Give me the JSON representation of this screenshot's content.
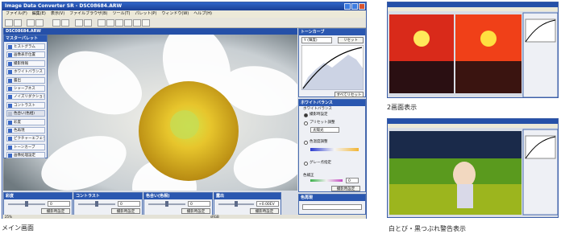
{
  "main_window": {
    "title": "Image Data Converter SR - DSC08684.ARW",
    "menus": [
      "ファイル(F)",
      "編集(E)",
      "表示(V)",
      "ファイルブラウザ(B)",
      "ツール(T)",
      "パレット(P)",
      "ウィンドウ(W)",
      "ヘルプ(H)"
    ],
    "image_title": "DSC08684.ARW",
    "master_palette": {
      "title": "マスターパレット",
      "items": [
        {
          "label": "ヒストグラム",
          "checked": true
        },
        {
          "label": "画像表示位置",
          "checked": true
        },
        {
          "label": "撮影情報",
          "checked": true
        },
        {
          "label": "ホワイトバランス",
          "checked": true
        },
        {
          "label": "露出",
          "checked": true
        },
        {
          "label": "シャープネス",
          "checked": true
        },
        {
          "label": "ノイズリダクション",
          "checked": true
        },
        {
          "label": "コントラスト",
          "checked": true
        },
        {
          "label": "色合い(色相)",
          "checked": false
        },
        {
          "label": "彩度",
          "checked": true
        },
        {
          "label": "色再現",
          "checked": true
        },
        {
          "label": "ピクチャーエフェクト",
          "checked": true
        },
        {
          "label": "トーンカーブ",
          "checked": true
        },
        {
          "label": "画像処理設定",
          "checked": true
        }
      ]
    },
    "tone_curve": {
      "title": "トーンカーブ",
      "channel": "Y (輝度)",
      "reset_button": "リセット",
      "reset_all_button": "すべてリセット"
    },
    "white_balance": {
      "title": "ホワイトバランス",
      "section_label": "ホワイトバランス",
      "options": [
        "撮影時設定",
        "プリセット調整",
        "色温度調整",
        "グレー点指定"
      ],
      "selected_index": 0,
      "preset_value": "太陽光",
      "color_filter_label": "色補正",
      "apply_button": "撮影時設定"
    },
    "color_space": {
      "title": "色再現"
    },
    "bottom_panels": [
      {
        "title": "彩度",
        "value": "0",
        "button": "撮影時設定"
      },
      {
        "title": "コントラスト",
        "value": "0",
        "button": "撮影時設定"
      },
      {
        "title": "色合い(色相)",
        "value": "0",
        "button": "撮影時設定"
      },
      {
        "title": "露出",
        "value": "+0.00EV",
        "button": "撮影時設定"
      }
    ],
    "status": {
      "zoom": "25%",
      "color_space": "sRGB"
    }
  },
  "captions": {
    "main": "メイン画面",
    "two_screen": "2画面表示",
    "warning": "白とび・黒つぶれ警告表示"
  }
}
